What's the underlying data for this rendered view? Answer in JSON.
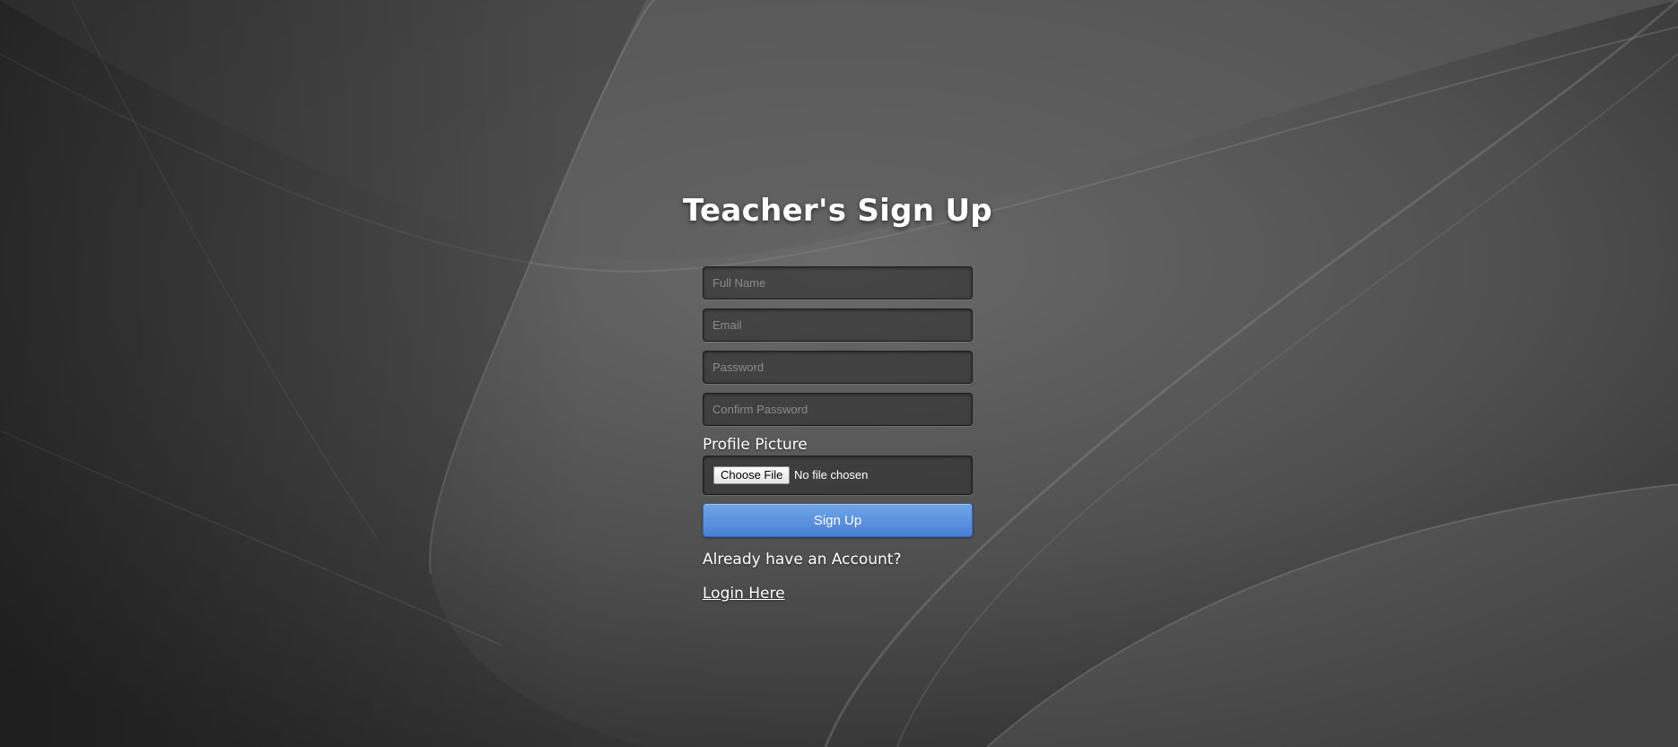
{
  "page": {
    "title": "Teacher's Sign Up"
  },
  "form": {
    "full_name": {
      "placeholder": "Full Name",
      "value": ""
    },
    "email": {
      "placeholder": "Email",
      "value": ""
    },
    "password": {
      "placeholder": "Password",
      "value": ""
    },
    "confirm_password": {
      "placeholder": "Confirm Password",
      "value": ""
    },
    "profile_picture": {
      "label": "Profile Picture",
      "button_label": "Choose File",
      "status": "No file chosen"
    },
    "submit_label": "Sign Up"
  },
  "footer": {
    "prompt": "Already have an Account?",
    "login_link": "Login Here"
  },
  "colors": {
    "background": "#474747",
    "primary_button": "#5a91de",
    "text": "#ffffff",
    "placeholder": "#8a8a8a"
  }
}
